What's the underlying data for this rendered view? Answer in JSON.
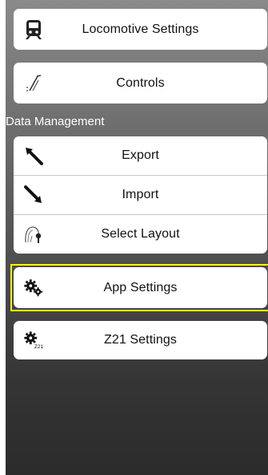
{
  "menu": {
    "locomotive_settings": "Locomotive Settings",
    "controls": "Controls",
    "section_data_management": "Data Management",
    "export": "Export",
    "import": "Import",
    "select_layout": "Select Layout",
    "app_settings": "App Settings",
    "z21_settings": "Z21 Settings",
    "z21_icon_text": "Z21"
  },
  "icons": {
    "locomotive": "train-icon",
    "controls": "control-lever-icon",
    "export": "arrow-up-left-icon",
    "import": "arrow-down-right-icon",
    "select_layout": "layout-icon",
    "app_settings": "gears-icon",
    "z21_settings": "z21-gear-icon"
  },
  "colors": {
    "highlight": "#f1f11a",
    "button_bg": "#ffffff",
    "text": "#111111"
  }
}
